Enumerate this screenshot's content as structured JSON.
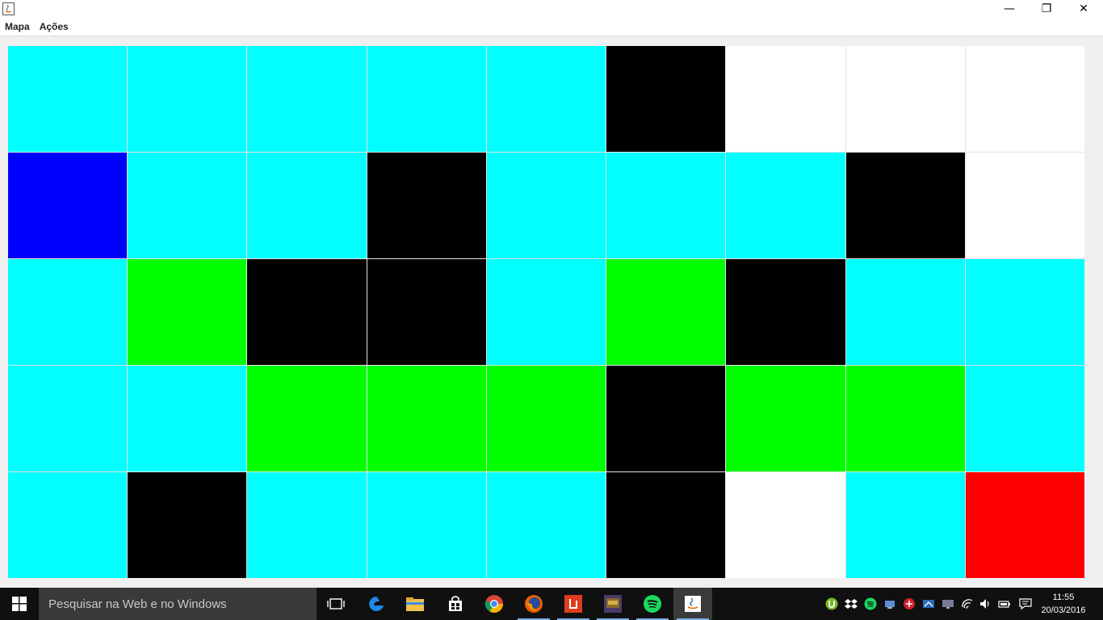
{
  "window": {
    "minimize_glyph": "—",
    "maximize_glyph": "❐",
    "close_glyph": "✕"
  },
  "menu": {
    "items": [
      "Mapa",
      "Ações"
    ]
  },
  "grid": {
    "rows": 5,
    "cols": 9,
    "cells": [
      [
        "#00ffff",
        "#00ffff",
        "#00ffff",
        "#00ffff",
        "#00ffff",
        "#000000",
        "#ffffff",
        "#ffffff",
        "#ffffff"
      ],
      [
        "#0000ff",
        "#00ffff",
        "#00ffff",
        "#000000",
        "#00ffff",
        "#00ffff",
        "#00ffff",
        "#000000",
        "#ffffff"
      ],
      [
        "#00ffff",
        "#00ff00",
        "#000000",
        "#000000",
        "#00ffff",
        "#00ff00",
        "#000000",
        "#00ffff",
        "#00ffff"
      ],
      [
        "#00ffff",
        "#00ffff",
        "#00ff00",
        "#00ff00",
        "#00ff00",
        "#000000",
        "#00ff00",
        "#00ff00",
        "#00ffff"
      ],
      [
        "#00ffff",
        "#000000",
        "#00ffff",
        "#00ffff",
        "#00ffff",
        "#000000",
        "#ffffff",
        "#00ffff",
        "#ff0000"
      ]
    ]
  },
  "taskbar": {
    "search_placeholder": "Pesquisar na Web e no Windows",
    "clock_time": "11:55",
    "clock_date": "20/03/2016",
    "apps": [
      "task-view-icon",
      "edge-icon",
      "file-explorer-icon",
      "store-icon",
      "chrome-icon",
      "firefox-icon",
      "app-red-icon",
      "game-icon",
      "spotify-icon",
      "java-icon"
    ]
  }
}
